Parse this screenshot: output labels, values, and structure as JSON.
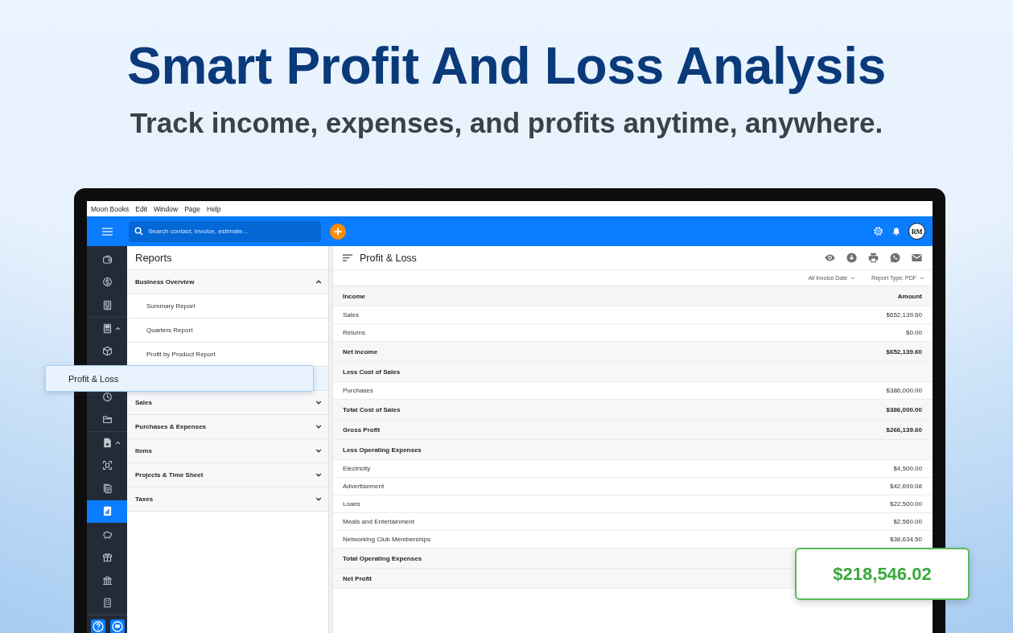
{
  "hero": {
    "title": "Smart Profit And Loss Analysis",
    "subtitle": "Track income, expenses, and profits anytime, anywhere."
  },
  "menu_bar": {
    "items": [
      "Moon Books",
      "Edit",
      "Window",
      "Page",
      "Help"
    ]
  },
  "top_bar": {
    "search": {
      "placeholder": "Search contact, invoice, estimate..."
    },
    "avatar": "RM"
  },
  "sidebar": {
    "items": [
      {
        "kind": "link",
        "selected": false
      },
      {
        "kind": "link",
        "selected": false
      },
      {
        "kind": "link",
        "selected": false
      },
      {
        "kind": "group",
        "expanded": true,
        "selected": false
      },
      {
        "kind": "link",
        "selected": false
      },
      {
        "kind": "link",
        "selected": false
      },
      {
        "kind": "link",
        "selected": false
      },
      {
        "kind": "group",
        "expanded": true,
        "selected": false
      },
      {
        "kind": "link",
        "selected": false
      },
      {
        "kind": "link",
        "selected": false
      },
      {
        "kind": "link",
        "selected": true
      },
      {
        "kind": "link",
        "selected": false
      },
      {
        "kind": "link",
        "selected": false
      },
      {
        "kind": "link",
        "selected": false
      },
      {
        "kind": "link",
        "selected": false
      }
    ]
  },
  "reports_panel": {
    "title": "Reports",
    "sections": [
      {
        "label": "Business Overview",
        "expanded": true,
        "items": [
          {
            "label": "Summary Report",
            "selected": false
          },
          {
            "label": "Quarters Report",
            "selected": false
          },
          {
            "label": "Profit by Product Report",
            "selected": false
          },
          {
            "label": "Profit & Loss",
            "selected": true
          }
        ]
      },
      {
        "label": "Sales",
        "expanded": false
      },
      {
        "label": "Purchases & Expenses",
        "expanded": false
      },
      {
        "label": "Items",
        "expanded": false
      },
      {
        "label": "Projects & Time Sheet",
        "expanded": false
      },
      {
        "label": "Taxes",
        "expanded": false
      }
    ]
  },
  "report": {
    "title": "Profit & Loss",
    "filters": [
      "All Invoice Date",
      "Report Type: PDF"
    ],
    "table": {
      "columns": [
        "Income",
        "Amount"
      ],
      "rows": [
        {
          "kind": "item",
          "label": "Sales",
          "amount": "$652,139.60"
        },
        {
          "kind": "item",
          "label": "Returns",
          "amount": "$0.00"
        },
        {
          "kind": "total",
          "label": "Net Income",
          "amount": "$652,139.60"
        },
        {
          "kind": "section",
          "label": "Less Cost of Sales"
        },
        {
          "kind": "item",
          "label": "Purchases",
          "amount": "$386,000.00"
        },
        {
          "kind": "total",
          "label": "Total Cost of Sales",
          "amount": "$386,000.00"
        },
        {
          "kind": "total",
          "label": "Gross Profit",
          "amount": "$266,139.60"
        },
        {
          "kind": "section",
          "label": "Less Operating Expenses"
        },
        {
          "kind": "item",
          "label": "Electricity",
          "amount": "$4,500.00"
        },
        {
          "kind": "item",
          "label": "Advertisement",
          "amount": "$42,699.08"
        },
        {
          "kind": "item",
          "label": "Loans",
          "amount": "$22,500.00"
        },
        {
          "kind": "item",
          "label": "Meals and Entertainment",
          "amount": "$2,560.00"
        },
        {
          "kind": "item",
          "label": "Networking Club Memberships",
          "amount": "$38,634.50"
        },
        {
          "kind": "total",
          "label": "Total Operating Expenses"
        },
        {
          "kind": "total",
          "label": "Net Profit"
        }
      ]
    }
  },
  "callout": {
    "value": "$218,546.02"
  }
}
